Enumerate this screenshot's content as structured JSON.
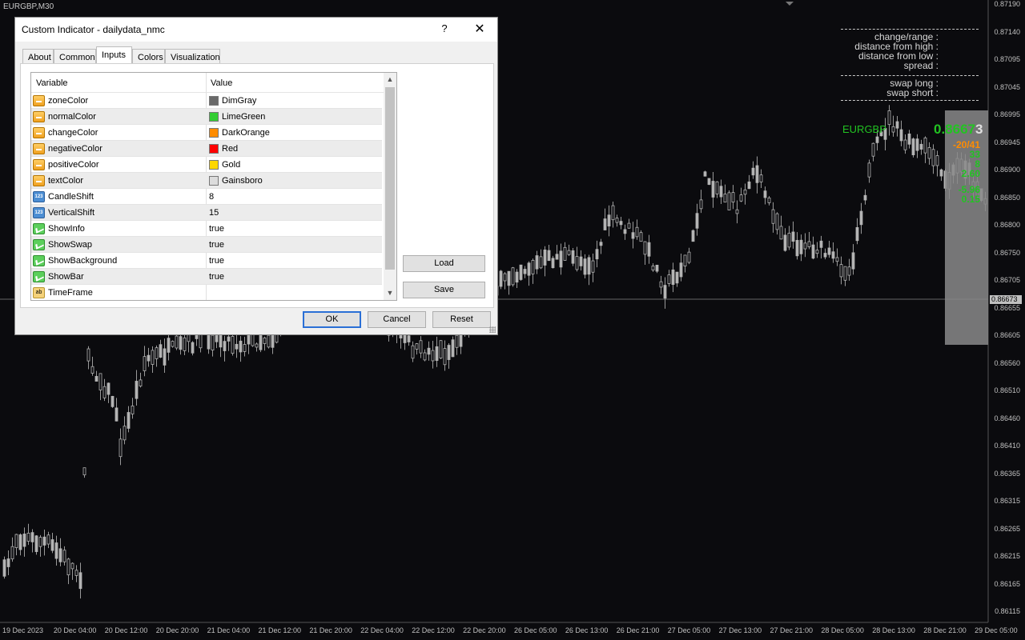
{
  "chart": {
    "symbol": "EURGBP,M30",
    "price_ticks": [
      "0.87190",
      "0.87140",
      "0.87095",
      "0.87045",
      "0.86995",
      "0.86945",
      "0.86900",
      "0.86850",
      "0.86800",
      "0.86750",
      "0.86705",
      "0.86655",
      "0.86605",
      "0.86560",
      "0.86510",
      "0.86460",
      "0.86410",
      "0.86365",
      "0.86315",
      "0.86265",
      "0.86215",
      "0.86165",
      "0.86115"
    ],
    "time_ticks": [
      "19 Dec 2023",
      "20 Dec 04:00",
      "20 Dec 12:00",
      "20 Dec 20:00",
      "21 Dec 04:00",
      "21 Dec 12:00",
      "21 Dec 20:00",
      "22 Dec 04:00",
      "22 Dec 12:00",
      "22 Dec 20:00",
      "26 Dec 05:00",
      "26 Dec 13:00",
      "26 Dec 21:00",
      "27 Dec 05:00",
      "27 Dec 13:00",
      "27 Dec 21:00",
      "28 Dec 05:00",
      "28 Dec 13:00",
      "28 Dec 21:00",
      "29 Dec 05:00"
    ],
    "current_price": "0.86673",
    "colors": {
      "background": "#0b0b0e",
      "candle": "#b4b4b4",
      "positive": "#22c322",
      "change": "#ff8c00"
    }
  },
  "info_panel": {
    "labels": [
      "change/range :",
      "distance from high :",
      "distance from low :",
      "spread :"
    ],
    "swap_labels": [
      "swap long :",
      "swap short :"
    ],
    "symbol_name": "EURGBP",
    "price_main": "0.8667",
    "price_last": "3",
    "stats": [
      {
        "text": "-20/41",
        "color": "#ff8c00"
      },
      {
        "text": "33",
        "color": "#22c322"
      },
      {
        "text": "8",
        "color": "#22c322"
      },
      {
        "text": "2.60",
        "color": "#22c322"
      },
      {
        "text": "-5.96",
        "color": "#22c322"
      },
      {
        "text": "0.15",
        "color": "#22c322"
      }
    ]
  },
  "dialog": {
    "title": "Custom Indicator - dailydata_nmc",
    "help": "?",
    "close": "✕",
    "tabs": [
      "About",
      "Common",
      "Inputs",
      "Colors",
      "Visualization"
    ],
    "active_tab": 2,
    "headers": {
      "variable": "Variable",
      "value": "Value"
    },
    "rows": [
      {
        "type": "color",
        "variable": "zoneColor",
        "value": "DimGray",
        "swatch": "#696969"
      },
      {
        "type": "color",
        "variable": "normalColor",
        "value": "LimeGreen",
        "swatch": "#32cd32"
      },
      {
        "type": "color",
        "variable": "changeColor",
        "value": "DarkOrange",
        "swatch": "#ff8c00"
      },
      {
        "type": "color",
        "variable": "negativeColor",
        "value": "Red",
        "swatch": "#ff0000"
      },
      {
        "type": "color",
        "variable": "positiveColor",
        "value": "Gold",
        "swatch": "#ffd700"
      },
      {
        "type": "color",
        "variable": "textColor",
        "value": "Gainsboro",
        "swatch": "#dcdcdc"
      },
      {
        "type": "int",
        "variable": "CandleShift",
        "value": "8"
      },
      {
        "type": "int",
        "variable": "VerticalShift",
        "value": "15"
      },
      {
        "type": "bool",
        "variable": "ShowInfo",
        "value": "true"
      },
      {
        "type": "bool",
        "variable": "ShowSwap",
        "value": "true"
      },
      {
        "type": "bool",
        "variable": "ShowBackground",
        "value": "true"
      },
      {
        "type": "bool",
        "variable": "ShowBar",
        "value": "true"
      },
      {
        "type": "string",
        "variable": "TimeFrame",
        "value": ""
      }
    ],
    "buttons": {
      "load": "Load",
      "save": "Save",
      "ok": "OK",
      "cancel": "Cancel",
      "reset": "Reset"
    }
  }
}
